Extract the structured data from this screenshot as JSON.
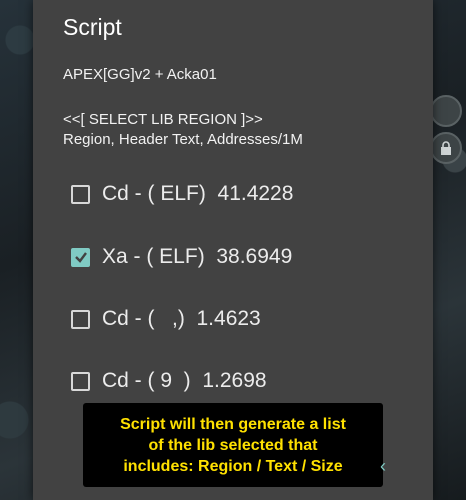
{
  "dialog": {
    "title": "Script",
    "script_name": "APEX[GG]v2 + Acka01",
    "section_header": "<<[ SELECT LIB REGION ]>>",
    "section_columns": "Region, Header Text, Addresses/1M",
    "options": [
      {
        "label": "Cd - ( ELF)  41.4228",
        "checked": false
      },
      {
        "label": "Xa - ( ELF)  38.6949",
        "checked": true
      },
      {
        "label": "Cd - (   ,)  1.4623",
        "checked": false
      },
      {
        "label": "Cd - ( 9  )  1.2698",
        "checked": false
      }
    ]
  },
  "tooltip": {
    "line1": "Script will then generate a list",
    "line2": "of the lib selected that",
    "line3": "includes: Region / Text / Size"
  },
  "colors": {
    "dialog_bg": "#424242",
    "accent": "#80cbc4",
    "tooltip_bg": "#000000",
    "tooltip_text": "#ffe100"
  },
  "icons": [
    "checkbox-icon",
    "check-icon",
    "lock-icon",
    "chevron-left-icon"
  ]
}
